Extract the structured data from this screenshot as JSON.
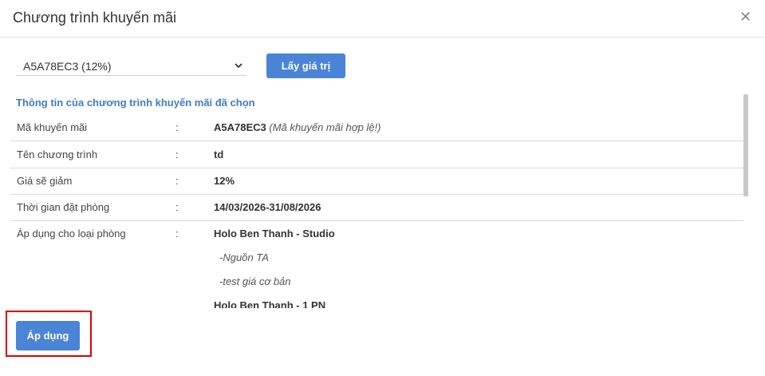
{
  "modal": {
    "title": "Chương trình khuyến mãi",
    "close_icon": "close-icon"
  },
  "promo_select": {
    "value": "A5A78EC3 (12%)",
    "icon": "chevron-down-icon"
  },
  "buttons": {
    "get_value": "Lấy giá trị",
    "apply": "Áp dụng"
  },
  "details": {
    "section_title": "Thông tin của chương trình khuyến mãi đã chọn",
    "colon": ":",
    "rows": [
      {
        "label": "Mã khuyến mãi",
        "value": "A5A78EC3",
        "note": "(Mã khuyến mãi hợp lệ!)"
      },
      {
        "label": "Tên chương trình",
        "value": "td"
      },
      {
        "label": "Giá sẽ giảm",
        "value": "12%"
      },
      {
        "label": "Thời gian đặt phòng",
        "value": "14/03/2026-31/08/2026"
      },
      {
        "label": "Áp dụng cho loại phòng",
        "value": "Holo Ben Thanh - Studio"
      }
    ],
    "room_types": [
      {
        "name": "Holo Ben Thanh - Studio",
        "rates": [
          "-Nguồn TA",
          "-test giá cơ bản"
        ]
      },
      {
        "name": "Holo Ben Thanh - 1 PN"
      }
    ]
  },
  "colors": {
    "primary": "#4a84d6",
    "section_title": "#3f7dc8",
    "highlight": "#e00000"
  }
}
